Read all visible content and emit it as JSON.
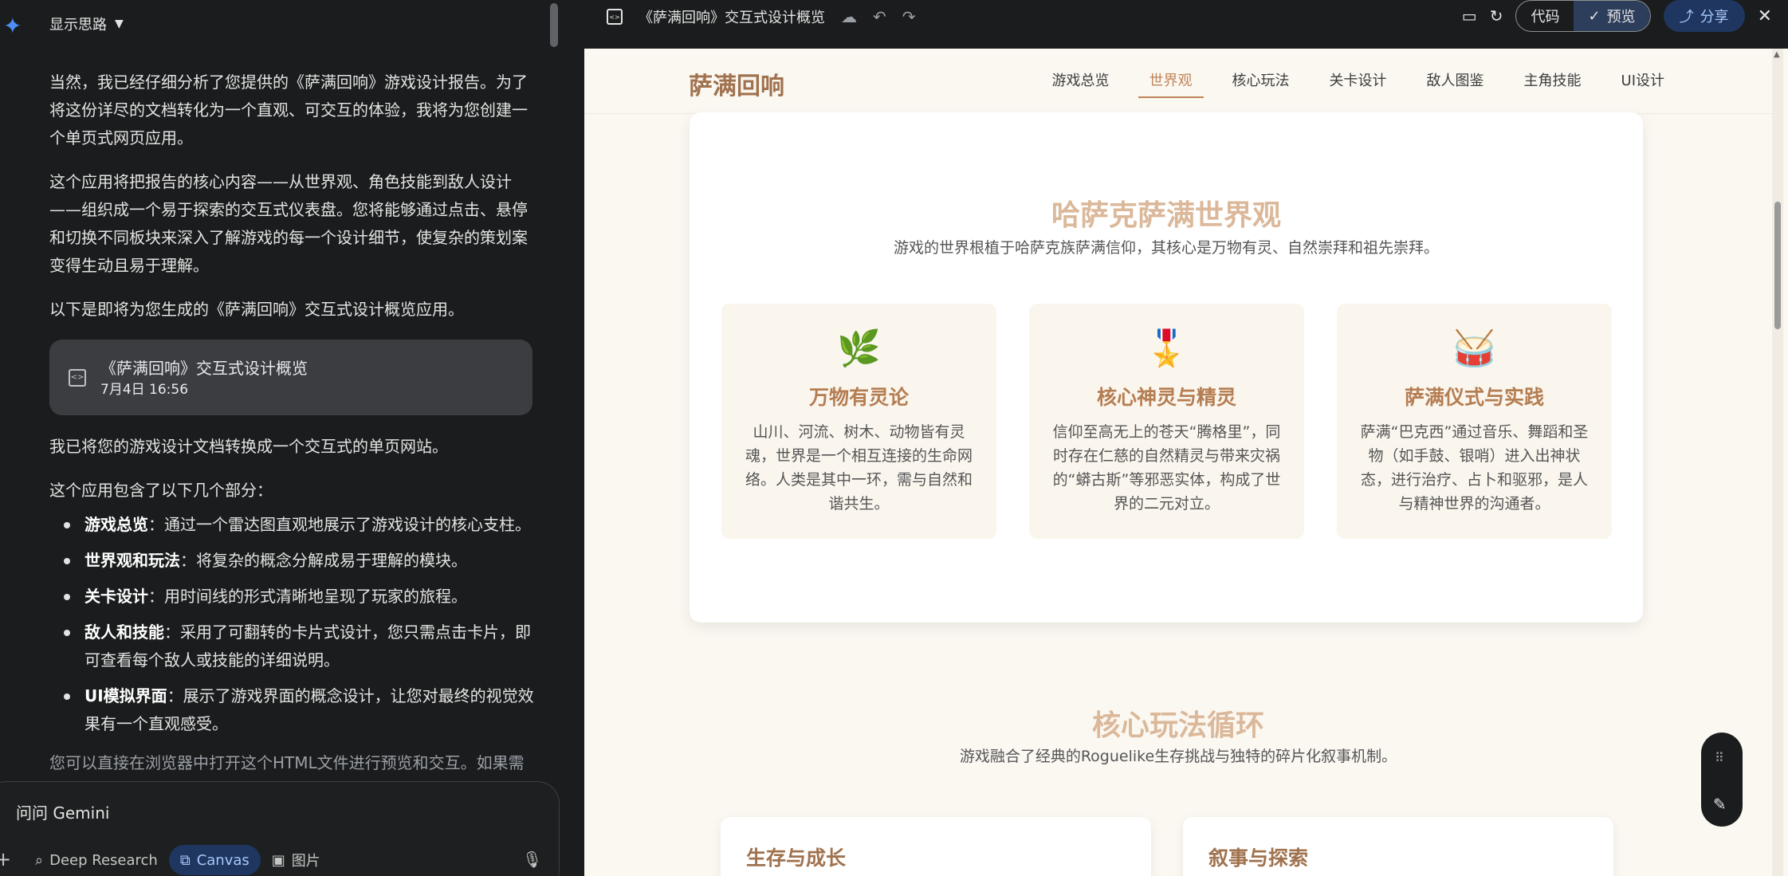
{
  "chat": {
    "thinking_label": "显示思路",
    "paragraphs": [
      "当然，我已经仔细分析了您提供的《萨满回响》游戏设计报告。为了将这份详尽的文档转化为一个直观、可交互的体验，我将为您创建一个单页式网页应用。",
      "这个应用将把报告的核心内容——从世界观、角色技能到敌人设计——组织成一个易于探索的交互式仪表盘。您将能够通过点击、悬停和切换不同板块来深入了解游戏的每一个设计细节，使复杂的策划案变得生动且易于理解。",
      "以下是即将为您生成的《萨满回响》交互式设计概览应用。"
    ],
    "doc_card": {
      "title": "《萨满回响》交互式设计概览",
      "date": "7月4日 16:56"
    },
    "after_card": "我已将您的游戏设计文档转换成一个交互式的单页网站。",
    "list_intro": "这个应用包含了以下几个部分：",
    "bullets": [
      {
        "bold": "游戏总览",
        "text": "：通过一个雷达图直观地展示了游戏设计的核心支柱。"
      },
      {
        "bold": "世界观和玩法",
        "text": "：将复杂的概念分解成易于理解的模块。"
      },
      {
        "bold": "关卡设计",
        "text": "：用时间线的形式清晰地呈现了玩家的旅程。"
      },
      {
        "bold": "敌人和技能",
        "text": "：采用了可翻转的卡片式设计，您只需点击卡片，即可查看每个敌人或技能的详细说明。"
      },
      {
        "bold": "UI模拟界面",
        "text": "：展示了游戏界面的概念设计，让您对最终的视觉效果有一个直观感受。"
      }
    ],
    "trailing": "您可以直接在浏览器中打开这个HTML文件进行预览和交互。如果需",
    "input_placeholder": "问问 Gemini",
    "tools": {
      "deep_research": "Deep Research",
      "canvas": "Canvas",
      "image": "图片"
    }
  },
  "canvas": {
    "title": "《萨满回响》交互式设计概览",
    "code_label": "代码",
    "preview_label": "预览",
    "share_label": "分享",
    "site": {
      "brand": "萨满回响",
      "nav": [
        "游戏总览",
        "世界观",
        "核心玩法",
        "关卡设计",
        "敌人图鉴",
        "主角技能",
        "UI设计"
      ],
      "active_nav": "世界观",
      "world": {
        "title": "哈萨克萨满世界观",
        "subtitle": "游戏的世界根植于哈萨克族萨满信仰，其核心是万物有灵、自然崇拜和祖先崇拜。",
        "features": [
          {
            "icon": "🌿",
            "title": "万物有灵论",
            "text": "山川、河流、树木、动物皆有灵魂，世界是一个相互连接的生命网络。人类是其中一环，需与自然和谐共生。"
          },
          {
            "icon": "🎖️",
            "title": "核心神灵与精灵",
            "text": "信仰至高无上的苍天“腾格里”，同时存在仁慈的自然精灵与带来灾祸的“蟒古斯”等邪恶实体，构成了世界的二元对立。"
          },
          {
            "icon": "🥁",
            "title": "萨满仪式与实践",
            "text": "萨满“巴克西”通过音乐、舞蹈和圣物（如手鼓、银哨）进入出神状态，进行治疗、占卜和驱邪，是人与精神世界的沟通者。"
          }
        ]
      },
      "loop": {
        "title": "核心玩法循环",
        "subtitle": "游戏融合了经典的Roguelike生存挑战与独特的碎片化叙事机制。",
        "cards": [
          "生存与成长",
          "叙事与探索"
        ]
      }
    }
  }
}
